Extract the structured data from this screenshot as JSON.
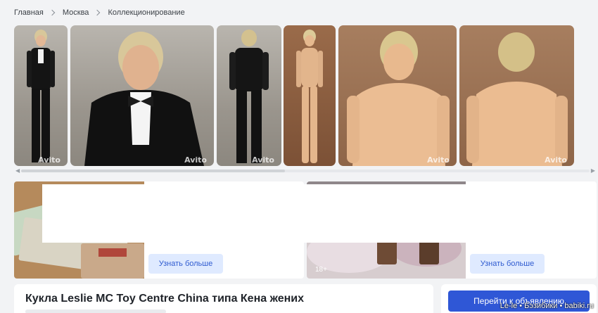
{
  "breadcrumb": {
    "items": [
      "Главная",
      "Москва",
      "Коллекционирование"
    ]
  },
  "gallery": {
    "watermark": "Avito",
    "photo_count": 6
  },
  "ads": [
    {
      "button_label": "Узнать больше"
    },
    {
      "button_label": "Узнать больше",
      "age_badge": "18+"
    }
  ],
  "listing": {
    "title": "Кукла Leslie MC Toy Centre China типа Кена жених",
    "goto_button": "Перейти к объявлению"
  },
  "site_watermark": "Le-le • Бэзибики • babiki.ru",
  "colors": {
    "accent": "#2f57d6",
    "ad_button_bg": "#dfeaff",
    "page_bg": "#f2f3f5"
  }
}
